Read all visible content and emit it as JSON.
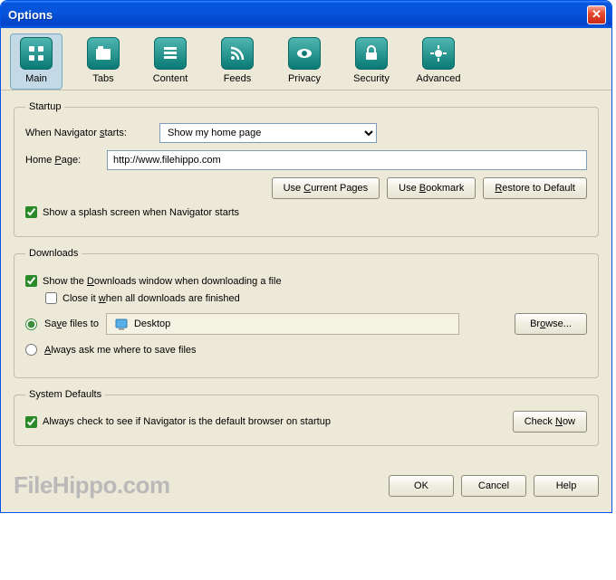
{
  "window": {
    "title": "Options"
  },
  "tabs": [
    {
      "label": "Main"
    },
    {
      "label": "Tabs"
    },
    {
      "label": "Content"
    },
    {
      "label": "Feeds"
    },
    {
      "label": "Privacy"
    },
    {
      "label": "Security"
    },
    {
      "label": "Advanced"
    }
  ],
  "startup": {
    "legend": "Startup",
    "when_label": "When Navigator starts:",
    "when_value": "Show my home page",
    "home_label": "Home Page:",
    "home_value": "http://www.filehippo.com",
    "use_current": "Use Current Pages",
    "use_bookmark": "Use Bookmark",
    "restore_default": "Restore to Default",
    "splash_label": "Show a splash screen when Navigator starts"
  },
  "downloads": {
    "legend": "Downloads",
    "show_window": "Show the Downloads window when downloading a file",
    "close_when_done": "Close it when all downloads are finished",
    "save_to_label": "Save files to",
    "save_path": "Desktop",
    "browse": "Browse...",
    "always_ask": "Always ask me where to save files"
  },
  "sysdef": {
    "legend": "System Defaults",
    "check_label": "Always check to see if Navigator is the default browser on startup",
    "check_now": "Check Now"
  },
  "buttons": {
    "ok": "OK",
    "cancel": "Cancel",
    "help": "Help"
  },
  "watermark": "FileHippo.com"
}
